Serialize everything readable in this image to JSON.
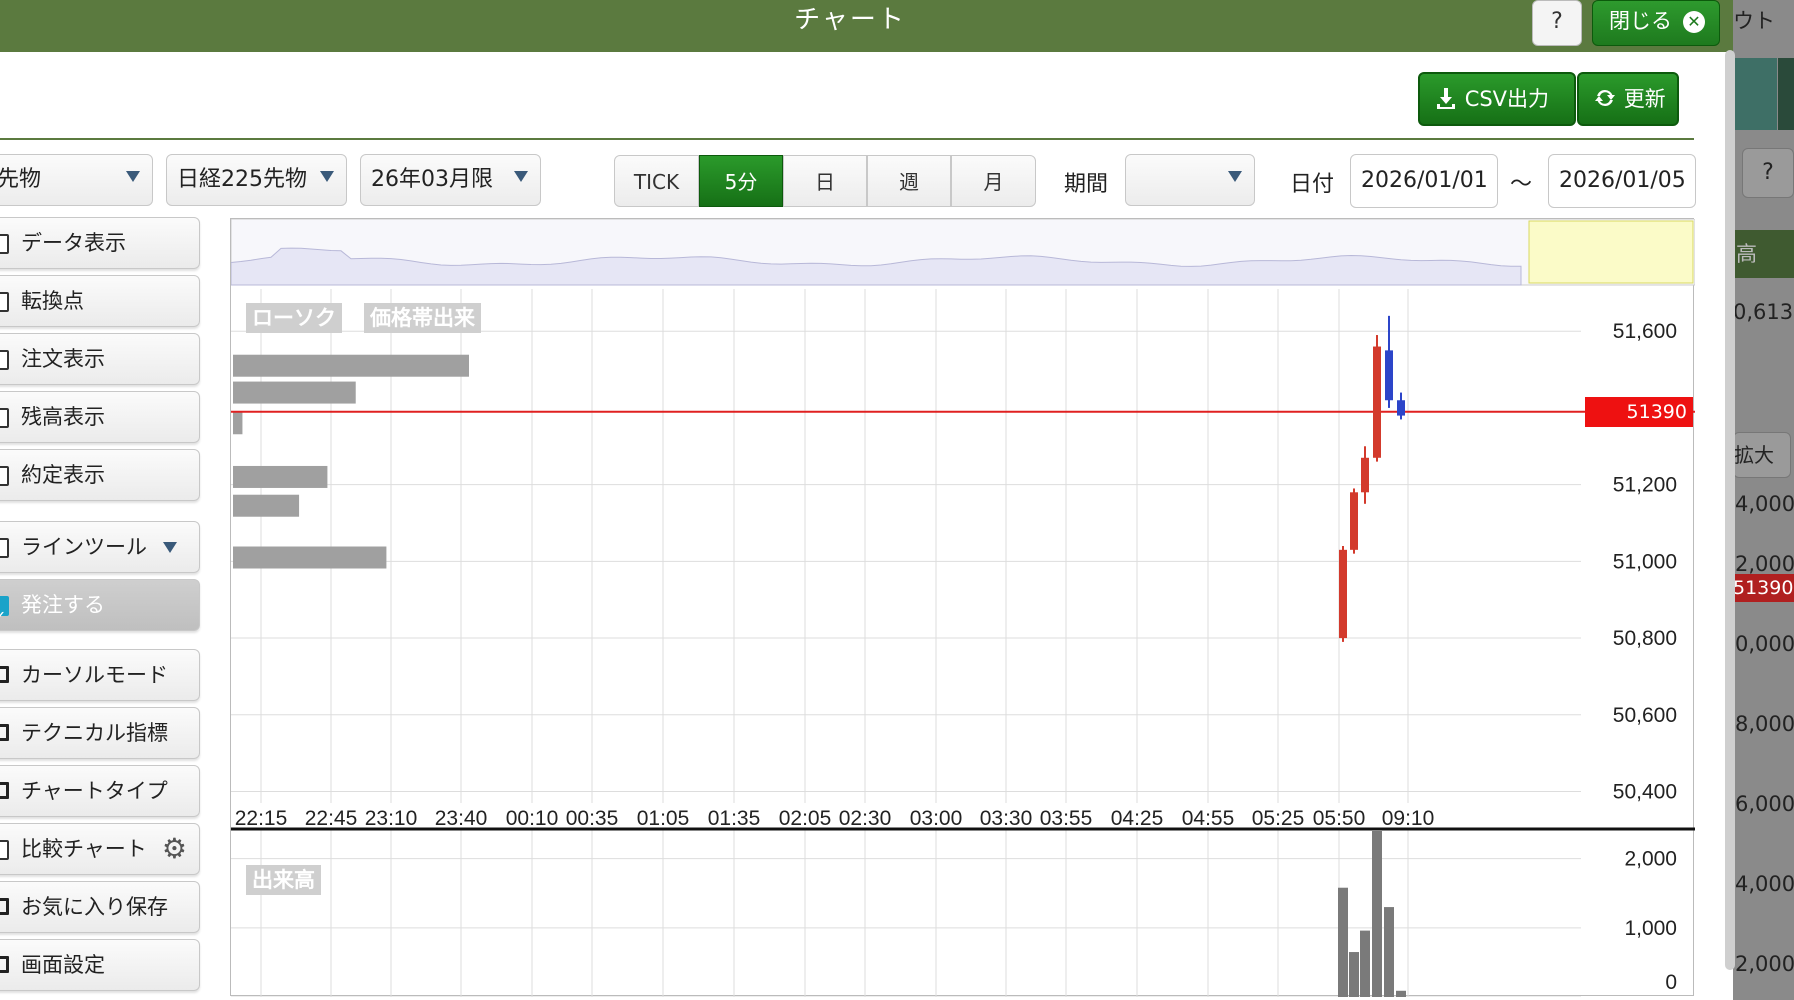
{
  "header": {
    "title": "チャート",
    "help_label": "?",
    "close_label": "閉じる",
    "logout_fragment": "ウト"
  },
  "toolbar": {
    "csv_label": "CSV出力",
    "refresh_label": "更新"
  },
  "selectors": {
    "category": "先物",
    "instrument": "日経225先物",
    "contract": "26年03月限",
    "period_label": "期間",
    "period_value": "",
    "date_label": "日付",
    "date_from": "2026/01/01",
    "date_sep": "～",
    "date_to": "2026/01/05"
  },
  "timeframes": [
    {
      "label": "TICK",
      "active": false
    },
    {
      "label": "5分",
      "active": true
    },
    {
      "label": "日",
      "active": false
    },
    {
      "label": "週",
      "active": false
    },
    {
      "label": "月",
      "active": false
    }
  ],
  "sidebar": {
    "items": [
      {
        "label": "データ表示",
        "icon": "checkbox",
        "checked": false
      },
      {
        "label": "転換点",
        "icon": "checkbox",
        "checked": false
      },
      {
        "label": "注文表示",
        "icon": "checkbox",
        "checked": false
      },
      {
        "label": "残高表示",
        "icon": "checkbox",
        "checked": false
      },
      {
        "label": "約定表示",
        "icon": "checkbox",
        "checked": false
      },
      {
        "label": "ラインツール",
        "icon": "checkbox",
        "checked": false,
        "dropdown": true
      },
      {
        "label": "発注する",
        "icon": "checkbox",
        "checked": true
      },
      {
        "label": "カーソルモード",
        "icon": "monitor-icon"
      },
      {
        "label": "テクニカル指標",
        "icon": "monitor-icon"
      },
      {
        "label": "チャートタイプ",
        "icon": "monitor-icon"
      },
      {
        "label": "比較チャート",
        "icon": "checkbox",
        "checked": false,
        "gear": true
      },
      {
        "label": "お気に入り保存",
        "icon": "monitor-icon"
      },
      {
        "label": "画面設定",
        "icon": "monitor-icon"
      }
    ]
  },
  "chart": {
    "main_tag": "ローソク",
    "volume_profile_tag": "価格帯出来",
    "volume_tag": "出来高",
    "current_price": "51390",
    "colors": {
      "up": "#d33a2c",
      "down": "#2c45c9",
      "price_line": "#e02020",
      "volume": "#7a7a7a"
    }
  },
  "right_panel": {
    "help_label": "?",
    "texts": [
      "高",
      "0,613",
      "拡大",
      "4,000",
      "2,000",
      "51390",
      "0,000",
      "8,000",
      "6,000",
      "4,000",
      "2,000"
    ]
  },
  "chart_data": {
    "type": "candlestick",
    "x_ticks": [
      "22:15",
      "22:45",
      "23:10",
      "23:40",
      "00:10",
      "00:35",
      "01:05",
      "01:35",
      "02:05",
      "02:30",
      "03:00",
      "03:30",
      "03:55",
      "04:25",
      "04:55",
      "05:25",
      "05:50",
      "09:10"
    ],
    "y_ticks": [
      51600,
      51200,
      51000,
      50800,
      50600,
      50400
    ],
    "ylim": [
      50370,
      51710
    ],
    "candles": [
      {
        "open": 50800,
        "close": 51030,
        "high": 51040,
        "low": 50790
      },
      {
        "open": 51030,
        "close": 51180,
        "high": 51190,
        "low": 51020
      },
      {
        "open": 51180,
        "close": 51270,
        "high": 51300,
        "low": 51150
      },
      {
        "open": 51270,
        "close": 51560,
        "high": 51590,
        "low": 51260
      },
      {
        "open": 51550,
        "close": 51420,
        "high": 51640,
        "low": 51400
      },
      {
        "open": 51420,
        "close": 51380,
        "high": 51440,
        "low": 51370
      }
    ],
    "price_line": 51390,
    "volume_ticks": [
      2000,
      1000,
      0
    ],
    "volume_ylim": [
      0,
      2400
    ],
    "volumes": [
      1580,
      650,
      960,
      2400,
      1300,
      90
    ],
    "volume_profile": [
      {
        "price": 51510,
        "value": 1.0
      },
      {
        "price": 51440,
        "value": 0.52
      },
      {
        "price": 51360,
        "value": 0.04
      },
      {
        "price": 51220,
        "value": 0.4
      },
      {
        "price": 51145,
        "value": 0.28
      },
      {
        "price": 51010,
        "value": 0.65
      }
    ]
  }
}
